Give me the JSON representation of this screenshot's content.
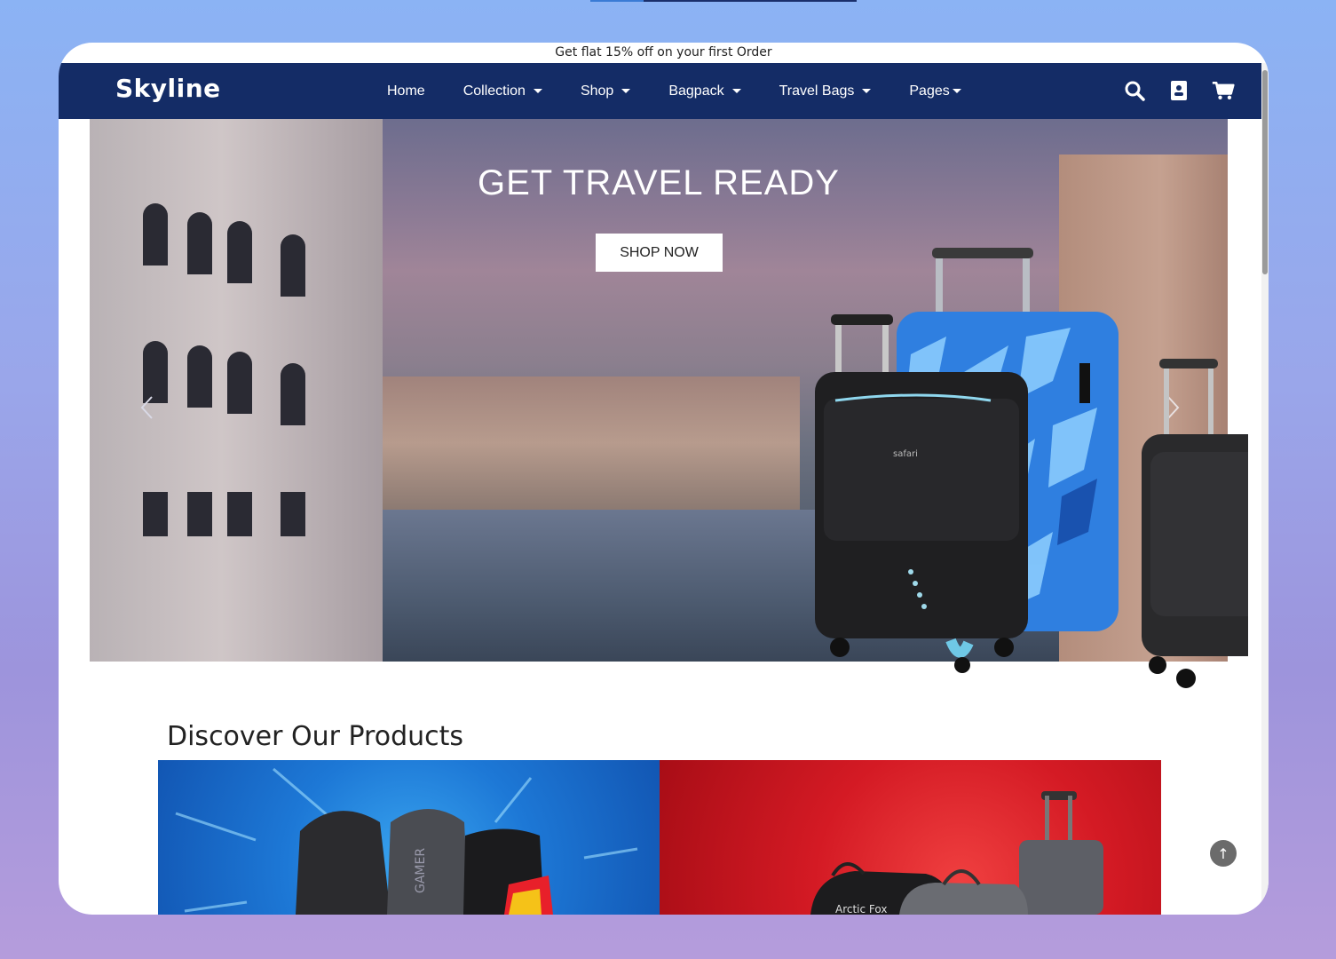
{
  "promo": {
    "text": "Get flat 15% off on your first Order"
  },
  "navbar": {
    "brand": "Skyline",
    "items": [
      {
        "label": "Home",
        "has_dropdown": false
      },
      {
        "label": "Collection",
        "has_dropdown": true
      },
      {
        "label": "Shop",
        "has_dropdown": true
      },
      {
        "label": "Bagpack",
        "has_dropdown": true
      },
      {
        "label": "Travel Bags",
        "has_dropdown": true
      },
      {
        "label": "Pages",
        "has_dropdown": true
      }
    ],
    "icons": [
      "search-icon",
      "account-icon",
      "cart-icon"
    ]
  },
  "hero": {
    "title": "GET  TRAVEL  READY",
    "button_label": "SHOP NOW",
    "luggage_brand_text": "safari"
  },
  "products_section": {
    "title": "Discover Our Products",
    "cards": [
      {
        "name": "backpacks",
        "background": "#1d78d6",
        "print_text": "GAMER"
      },
      {
        "name": "travel-bags",
        "background": "#d41a24",
        "print_text": "Arctic Fox"
      }
    ]
  },
  "scroll_top": {
    "symbol": "↑"
  },
  "colors": {
    "navbar": "#142c66",
    "page_bg": "#ffffff",
    "accent_blue": "#1d78d6",
    "accent_red": "#d41a24"
  }
}
